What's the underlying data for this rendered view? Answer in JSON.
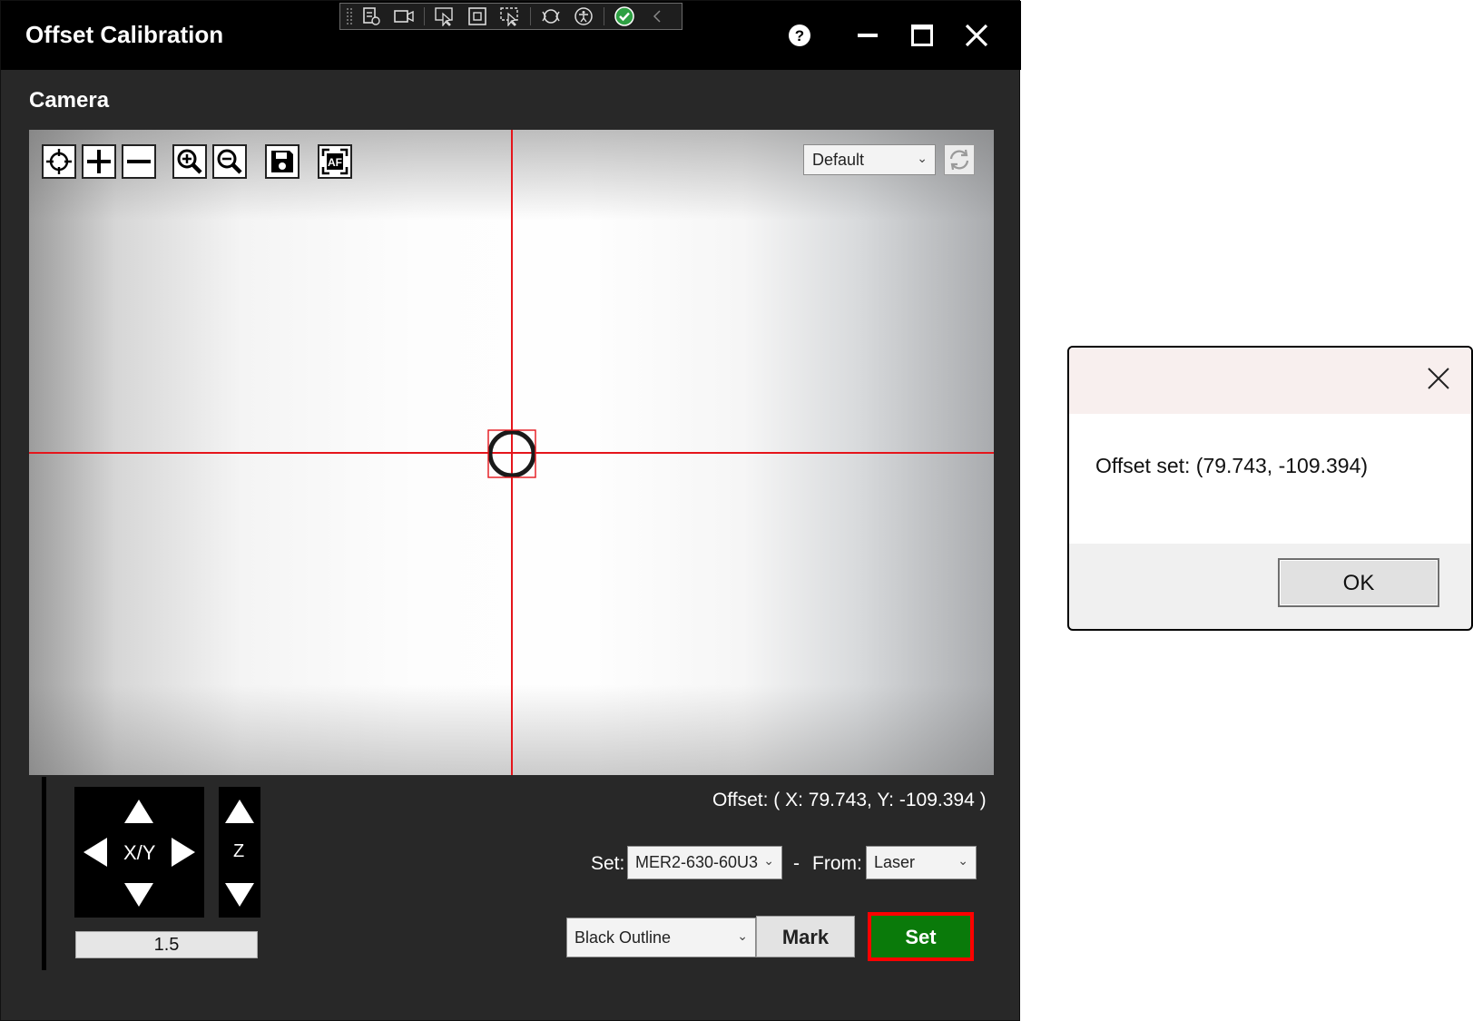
{
  "window": {
    "title": "Offset Calibration"
  },
  "camera": {
    "section_title": "Camera",
    "preset_value": "Default",
    "tools": [
      "crosshair-icon",
      "plus-icon",
      "minus-icon",
      "zoom-in-icon",
      "zoom-out-icon",
      "save-icon",
      "autofocus-icon"
    ]
  },
  "jog": {
    "xy_label": "X/Y",
    "z_label": "Z",
    "step_value": "1.5"
  },
  "offset": {
    "readout": "Offset: ( X: 79.743, Y: -109.394 )",
    "set_label": "Set:",
    "camera_value": "MER2-630-60U3",
    "separator": "-",
    "from_label": "From:",
    "from_value": "Laser",
    "style_value": "Black Outline",
    "mark_label": "Mark",
    "set_button_label": "Set"
  },
  "dialog": {
    "message": "Offset set: (79.743, -109.394)",
    "ok_label": "OK"
  },
  "colors": {
    "crosshair": "#e5151b",
    "set_button": "#0a7a0a",
    "highlight": "#ff0000"
  }
}
